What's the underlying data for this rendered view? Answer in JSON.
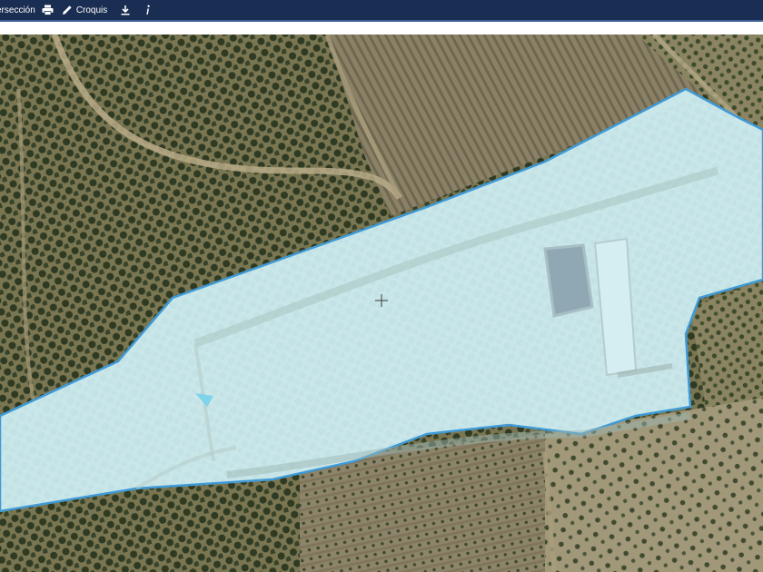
{
  "toolbar": {
    "items": [
      {
        "label": "ersección",
        "icon": "intersection"
      },
      {
        "label": "",
        "icon": "printer-icon"
      },
      {
        "label": "Croquis",
        "icon": "pencil-icon"
      },
      {
        "label": "",
        "icon": "download-icon"
      },
      {
        "label": "",
        "icon": "info-icon"
      }
    ]
  },
  "map": {
    "type": "aerial-orthophoto",
    "parcel_highlight_color": "#cfeff4",
    "parcel_outline_color": "#3f9ad6",
    "cursor": "crosshair"
  },
  "colors": {
    "toolbar_bg": "#1a2d52",
    "toolbar_text": "#ffffff"
  }
}
